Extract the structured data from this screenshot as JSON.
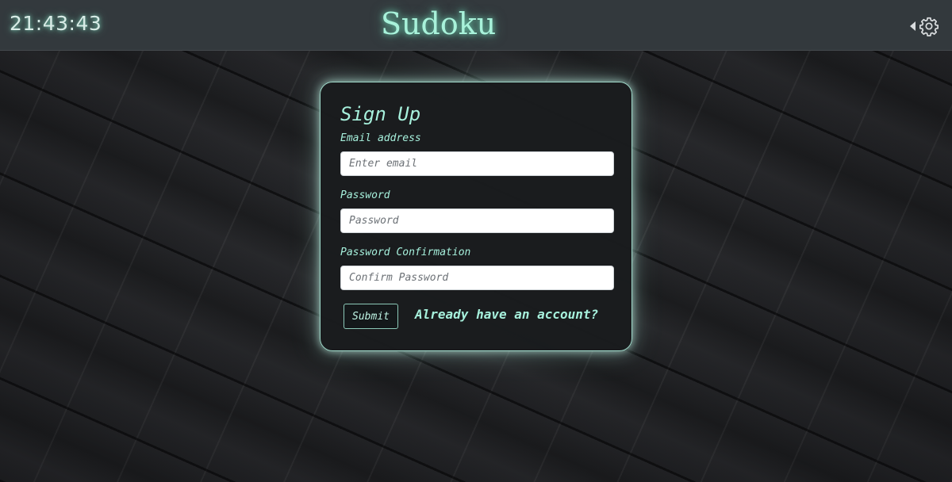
{
  "header": {
    "clock": "21:43:43",
    "title": "Sudoku",
    "settings_icon": "gear-icon",
    "expand_icon": "caret-left-icon"
  },
  "form": {
    "title": "Sign Up",
    "email": {
      "label": "Email address",
      "placeholder": "Enter email",
      "value": ""
    },
    "password": {
      "label": "Password",
      "placeholder": "Password",
      "value": ""
    },
    "password_confirmation": {
      "label": "Password Confirmation",
      "placeholder": "Confirm Password",
      "value": ""
    },
    "submit_label": "Submit",
    "login_link": "Already have an account?"
  },
  "colors": {
    "accent": "#a6f0dc",
    "header_bg": "#33393d",
    "card_bg": "#1a1c1e"
  }
}
